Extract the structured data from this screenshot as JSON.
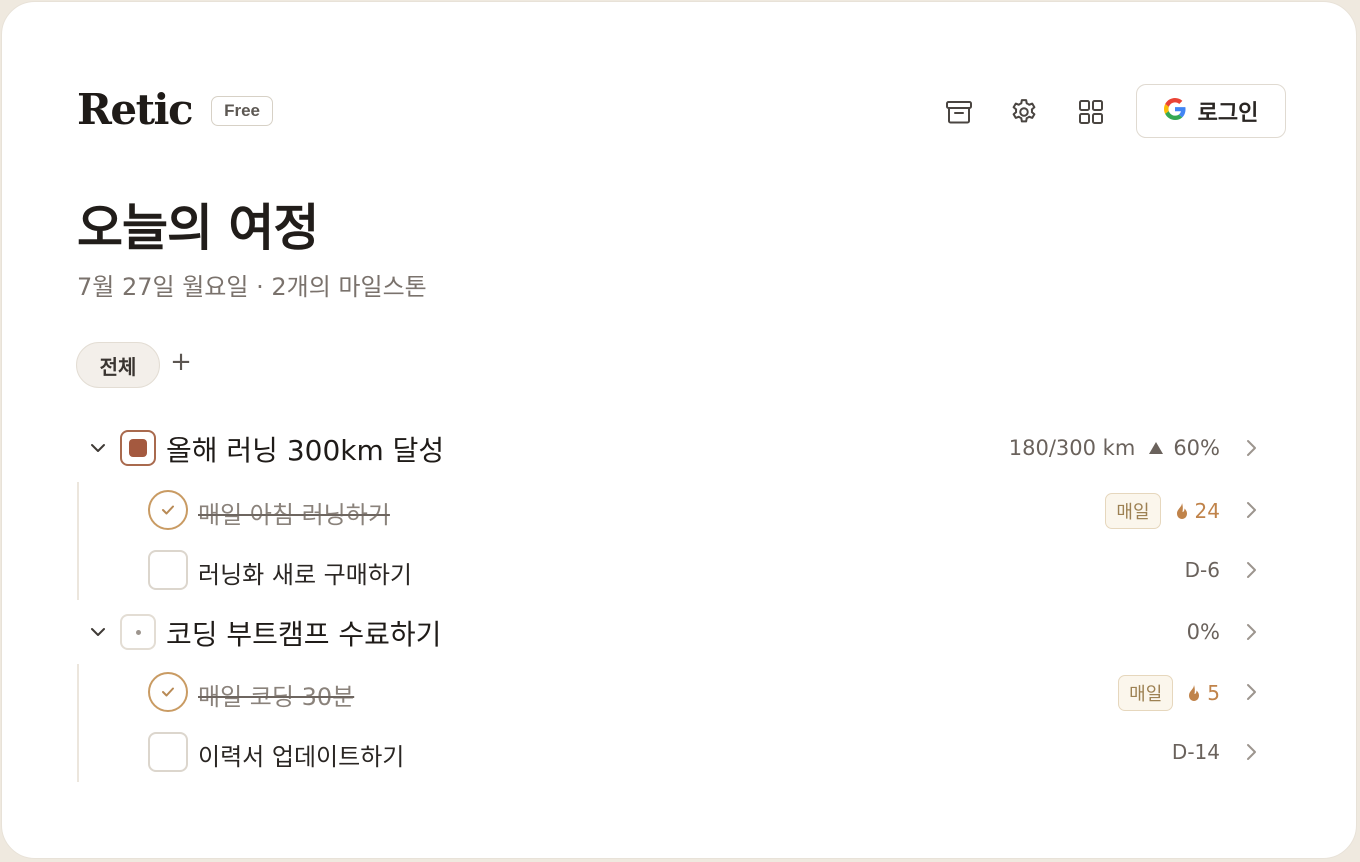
{
  "app": {
    "logo": "Retic",
    "plan_badge": "Free"
  },
  "header": {
    "icons": [
      "archive-icon",
      "gear-icon",
      "grid-icon"
    ],
    "login_label": "로그인"
  },
  "page": {
    "title": "오늘의 여정",
    "subtitle": "7월 27일 월요일 · 2개의 마일스톤"
  },
  "filters": {
    "active": "전체",
    "add_symbol": "+"
  },
  "goals": [
    {
      "title": "올해 러닝 300km 달성",
      "progress_text": "180/300 km",
      "percent_text": "60%",
      "percent_value": 60,
      "status": "active",
      "tasks": [
        {
          "title": "매일 아침 러닝하기",
          "done": true,
          "repeat_label": "매일",
          "streak": "24"
        },
        {
          "title": "러닝화 새로 구매하기",
          "done": false,
          "due": "D-6"
        }
      ]
    },
    {
      "title": "코딩 부트캠프 수료하기",
      "percent_text": "0%",
      "percent_value": 0,
      "status": "idle",
      "tasks": [
        {
          "title": "매일 코딩 30분",
          "done": true,
          "repeat_label": "매일",
          "streak": "5"
        },
        {
          "title": "이력서 업데이트하기",
          "done": false,
          "due": "D-14"
        }
      ]
    }
  ],
  "colors": {
    "accent": "#a4593f",
    "check_ring": "#c99b63",
    "streak_flame": "#c0834a",
    "daily_chip_bg": "#fbf6ec"
  }
}
